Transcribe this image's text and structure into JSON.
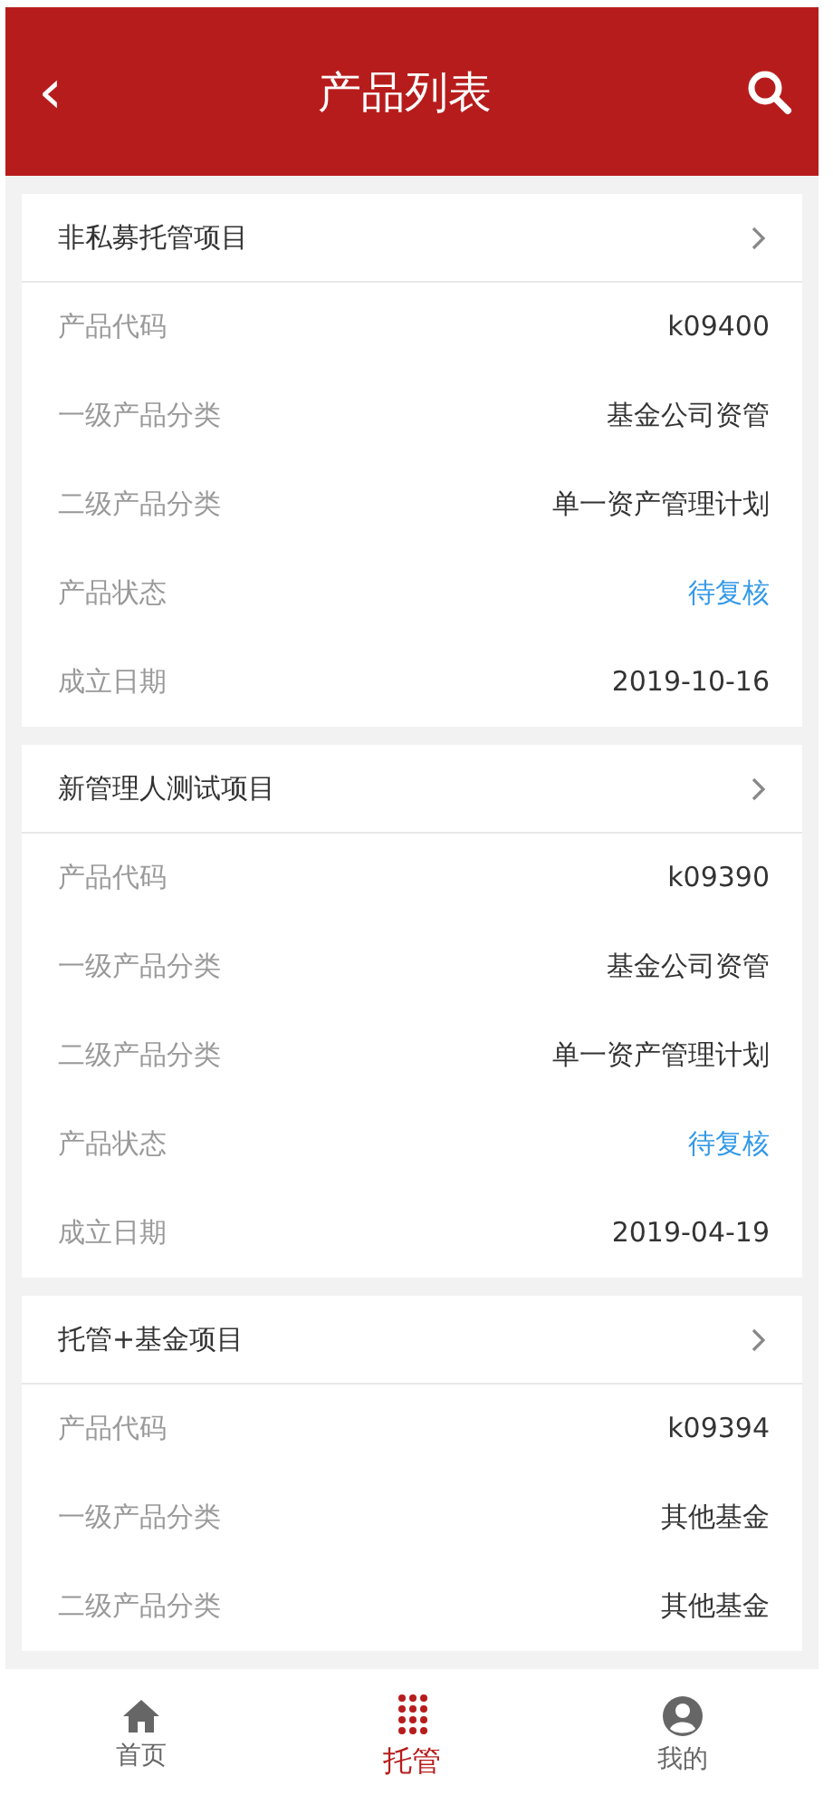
{
  "header": {
    "back": "‹",
    "title": "产品列表"
  },
  "products": [
    {
      "name": "非私募托管项目",
      "fields": [
        {
          "label": "产品代码",
          "value": "k09400",
          "kind": "text"
        },
        {
          "label": "一级产品分类",
          "value": "基金公司资管",
          "kind": "text"
        },
        {
          "label": "二级产品分类",
          "value": "单一资产管理计划",
          "kind": "text"
        },
        {
          "label": "产品状态",
          "value": "待复核",
          "kind": "status"
        },
        {
          "label": "成立日期",
          "value": "2019-10-16",
          "kind": "text"
        }
      ]
    },
    {
      "name": "新管理人测试项目",
      "fields": [
        {
          "label": "产品代码",
          "value": "k09390",
          "kind": "text"
        },
        {
          "label": "一级产品分类",
          "value": "基金公司资管",
          "kind": "text"
        },
        {
          "label": "二级产品分类",
          "value": "单一资产管理计划",
          "kind": "text"
        },
        {
          "label": "产品状态",
          "value": "待复核",
          "kind": "status"
        },
        {
          "label": "成立日期",
          "value": "2019-04-19",
          "kind": "text"
        }
      ]
    },
    {
      "name": "托管+基金项目",
      "fields": [
        {
          "label": "产品代码",
          "value": "k09394",
          "kind": "text"
        },
        {
          "label": "一级产品分类",
          "value": "其他基金",
          "kind": "text"
        },
        {
          "label": "二级产品分类",
          "value": "其他基金",
          "kind": "text"
        }
      ]
    }
  ],
  "tabbar": [
    {
      "label": "首页",
      "kind": "home",
      "selected": false
    },
    {
      "label": "托管",
      "kind": "dots",
      "selected": true
    },
    {
      "label": "我的",
      "kind": "user",
      "selected": false
    }
  ]
}
